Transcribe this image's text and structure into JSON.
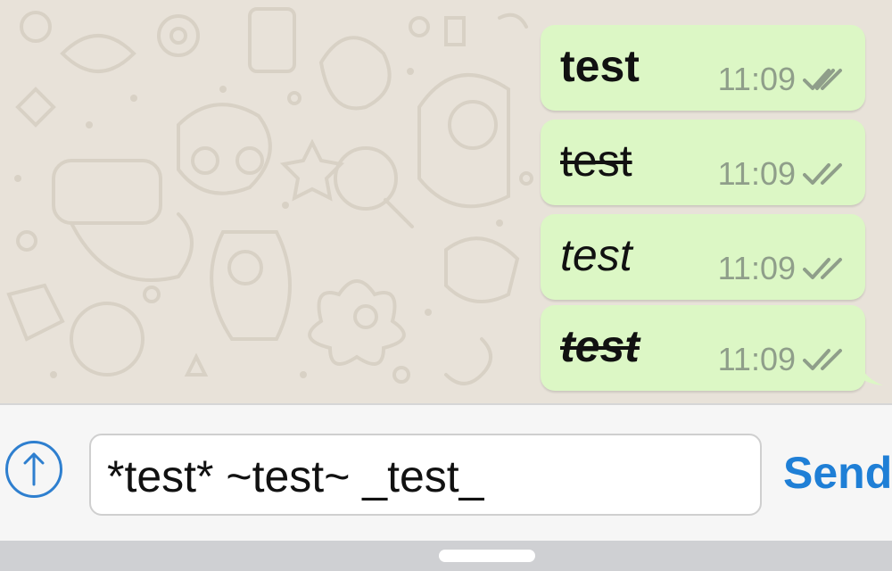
{
  "chat": {
    "wallpaper": "doodle-pattern",
    "messages": [
      {
        "text": "test",
        "style": "bold",
        "time": "11:09",
        "status_icon": "double-check-icon"
      },
      {
        "text": "test",
        "style": "strikethrough",
        "time": "11:09",
        "status_icon": "double-check-icon"
      },
      {
        "text": "test",
        "style": "italic",
        "time": "11:09",
        "status_icon": "double-check-icon"
      },
      {
        "text": "test",
        "style": "bold-italic-strikethrough",
        "time": "11:09",
        "status_icon": "double-check-icon"
      }
    ]
  },
  "composer": {
    "attach_icon": "arrow-up-circle-icon",
    "input_value": "*test* ~test~ _test_",
    "send_label": "Send"
  },
  "colors": {
    "bubble_background": "#dcf7c5",
    "wallpaper_background": "#e8e2d9",
    "accent": "#1f7fd6",
    "time_text": "#8f9e8a"
  }
}
